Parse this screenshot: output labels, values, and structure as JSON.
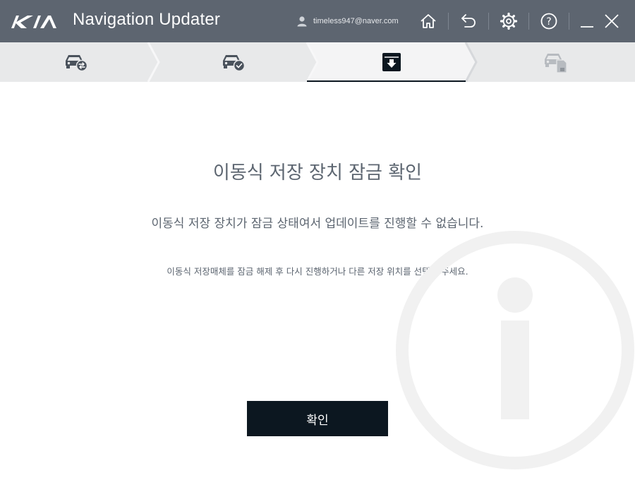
{
  "app": {
    "brand": "KIA",
    "title": "Navigation Updater",
    "user_email": "timeless947@naver.com"
  },
  "toolbar": {
    "icons": [
      "user-icon",
      "home-icon",
      "back-icon",
      "settings-icon",
      "help-icon",
      "minimize-icon",
      "close-icon"
    ]
  },
  "steps": [
    {
      "icon": "car-sync-icon",
      "state": "done"
    },
    {
      "icon": "car-check-icon",
      "state": "done"
    },
    {
      "icon": "download-icon",
      "state": "active"
    },
    {
      "icon": "car-sdcard-icon",
      "state": "pending"
    }
  ],
  "content": {
    "title": "이동식 저장 장치 잠금 확인",
    "message": "이동식 저장 장치가 잠금 상태여서 업데이트를 진행할 수 없습니다.",
    "sub_message": "이동식 저장매체를 잠금 해제 후 다시 진행하거나 다른 저장 위치를 선택해 주세요.",
    "confirm_label": "확인",
    "watermark_icon": "info-icon"
  },
  "colors": {
    "titlebar": "#5d6570",
    "stepper_bg": "#e8e9ea",
    "active_step_bg": "#f4f4f5",
    "text": "#5c6570",
    "button_bg": "#0c1720",
    "watermark": "#f1f1f1"
  }
}
